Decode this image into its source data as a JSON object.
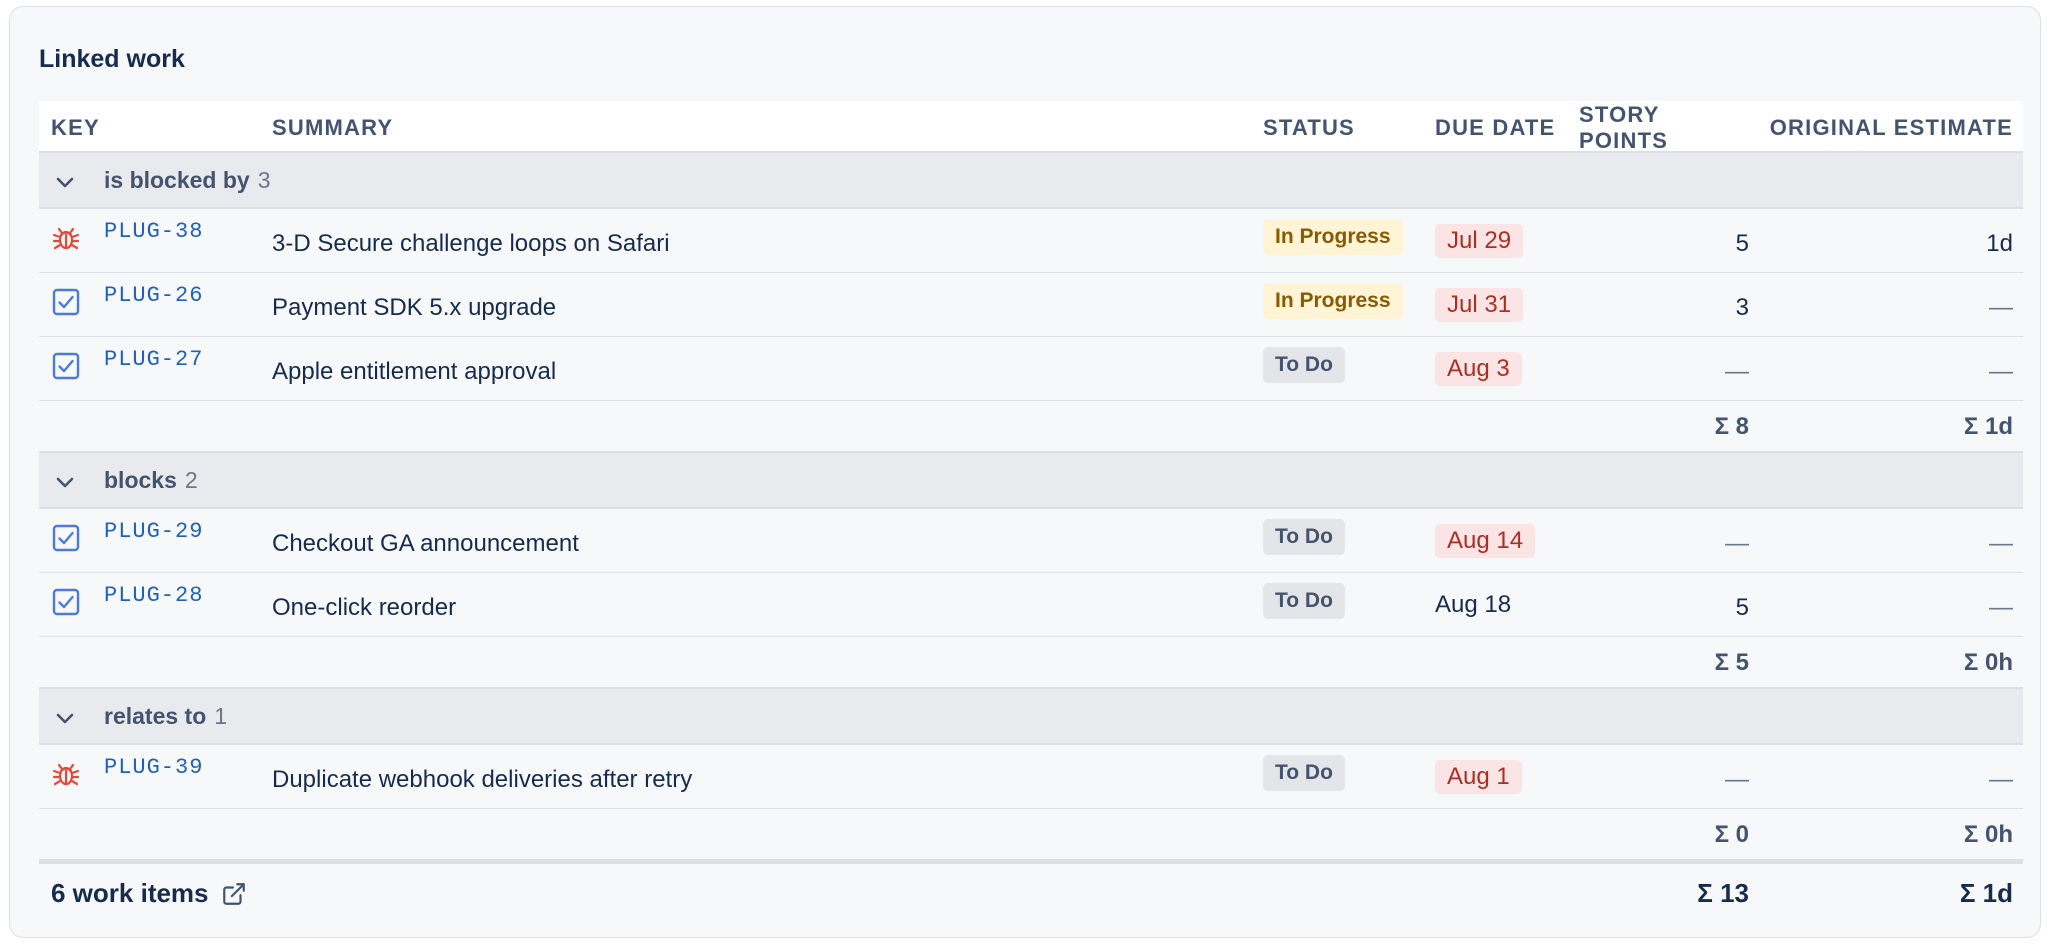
{
  "panel": {
    "title": "Linked work"
  },
  "columns": {
    "key": "KEY",
    "summary": "SUMMARY",
    "status": "STATUS",
    "due": "DUE DATE",
    "story_points": "STORY POINTS",
    "original_estimate": "ORIGINAL ESTIMATE"
  },
  "groups": [
    {
      "label": "is blocked by",
      "count": "3",
      "items": [
        {
          "type": "bug-icon",
          "key": "PLUG-38",
          "summary": "3-D Secure challenge loops on Safari",
          "status": "In Progress",
          "due": "Jul 29",
          "due_overdue": true,
          "story_points": "5",
          "original_estimate": "1d"
        },
        {
          "type": "task-icon",
          "key": "PLUG-26",
          "summary": "Payment SDK 5.x upgrade",
          "status": "In Progress",
          "due": "Jul 31",
          "due_overdue": true,
          "story_points": "3",
          "original_estimate": "—"
        },
        {
          "type": "task-icon",
          "key": "PLUG-27",
          "summary": "Apple entitlement approval",
          "status": "To Do",
          "due": "Aug 3",
          "due_overdue": true,
          "story_points": "—",
          "original_estimate": "—"
        }
      ],
      "subtotal_sp": "Σ 8",
      "subtotal_oe": "Σ 1d"
    },
    {
      "label": "blocks",
      "count": "2",
      "items": [
        {
          "type": "task-icon",
          "key": "PLUG-29",
          "summary": "Checkout GA announcement",
          "status": "To Do",
          "due": "Aug 14",
          "due_overdue": true,
          "story_points": "—",
          "original_estimate": "—"
        },
        {
          "type": "task-icon",
          "key": "PLUG-28",
          "summary": "One-click reorder",
          "status": "To Do",
          "due": "Aug 18",
          "due_overdue": false,
          "story_points": "5",
          "original_estimate": "—"
        }
      ],
      "subtotal_sp": "Σ 5",
      "subtotal_oe": "Σ 0h"
    },
    {
      "label": "relates to",
      "count": "1",
      "items": [
        {
          "type": "bug-icon",
          "key": "PLUG-39",
          "summary": "Duplicate webhook deliveries after retry",
          "status": "To Do",
          "due": "Aug 1",
          "due_overdue": true,
          "story_points": "—",
          "original_estimate": "—"
        }
      ],
      "subtotal_sp": "Σ 0",
      "subtotal_oe": "Σ 0h"
    }
  ],
  "footer": {
    "label": "6 work items",
    "total_sp": "Σ 13",
    "total_oe": "Σ 1d"
  },
  "colors": {
    "link": "#1f5fbf",
    "bug": "#e5493a",
    "task": "#4c7bd9",
    "in_progress_bg": "#fff4d6",
    "overdue_bg": "#fbe4e4"
  }
}
